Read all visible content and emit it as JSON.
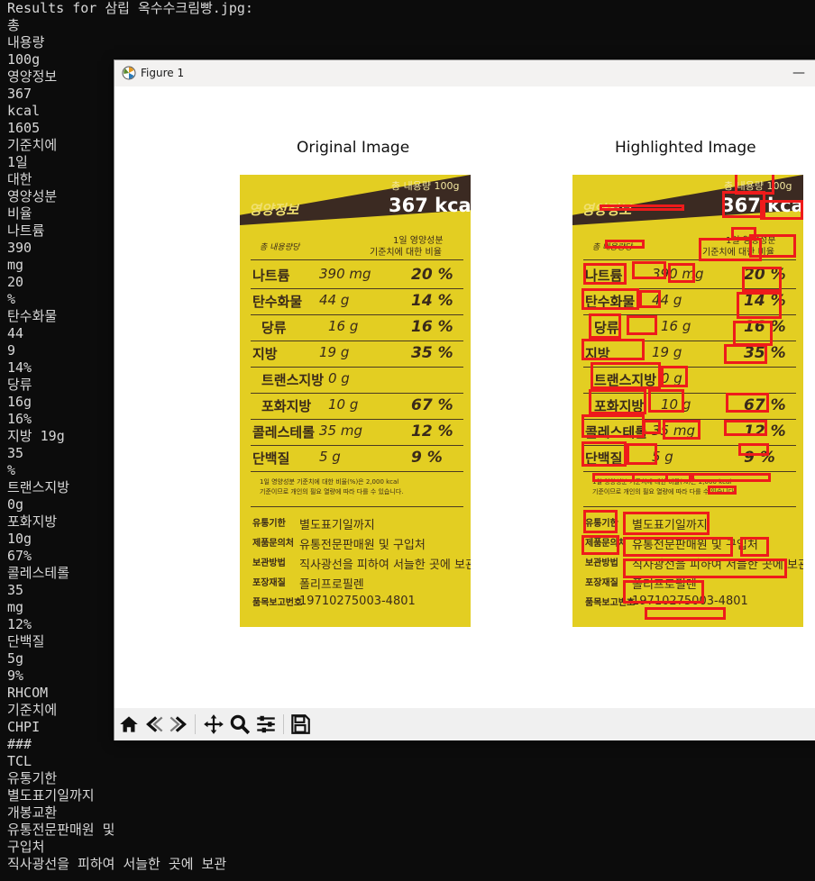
{
  "terminal": {
    "lines": [
      "Results for 삼립 옥수수크림빵.jpg:",
      "총",
      "내용량",
      "100g",
      "영양정보",
      "367",
      "kcal",
      "1605",
      "기준치에",
      "1일",
      "대한",
      "영양성분",
      "비율",
      "나트륨",
      "390",
      "mg",
      "20",
      "%",
      "탄수화물",
      "44",
      "9",
      "14%",
      "당류",
      "16g",
      "16%",
      "지방 19g",
      "35",
      "%",
      "트랜스지방",
      "0g",
      "포화지방",
      "10g",
      "67%",
      "콜레스테롤",
      "35",
      "mg",
      "12%",
      "단백질",
      "5g",
      "9%",
      "RHCOM",
      "기준치에",
      "CHPI",
      "###",
      "TCL",
      "유통기한",
      "별도표기일까지",
      "개봉교환",
      "유통전문판매원 및",
      "구입처",
      "직사광선을 피하여 서늘한 곳에 보관"
    ]
  },
  "window": {
    "title": "Figure 1",
    "min_glyph": "—"
  },
  "figure": {
    "left_title": "Original Image",
    "right_title": "Highlighted Image"
  },
  "label": {
    "top_line1": "총 내용량 100g",
    "top_line2": "367 kcal",
    "brand": "영양정보",
    "sub_left": "총 내용량당",
    "sub_right1": "1일 영양성분",
    "sub_right2": "기준치에 대한 비율",
    "rows": [
      {
        "name": "나트륨",
        "amount": "390 mg",
        "pct": "20 %"
      },
      {
        "name": "탄수화물",
        "amount": "44 g",
        "pct": "14 %"
      },
      {
        "name": "당류",
        "amount": "16 g",
        "pct": "16 %"
      },
      {
        "name": "지방",
        "amount": "19 g",
        "pct": "35 %"
      },
      {
        "name": "트랜스지방",
        "amount": "0 g",
        "pct": ""
      },
      {
        "name": "포화지방",
        "amount": "10 g",
        "pct": "67 %"
      },
      {
        "name": "콜레스테롤",
        "amount": "35 mg",
        "pct": "12 %"
      },
      {
        "name": "단백질",
        "amount": "5 g",
        "pct": "9 %"
      }
    ],
    "footnote1": "1일 영양성분 기준치에 대한 비율(%)은 2,000 kcal",
    "footnote2": "기준이므로 개인의 필요 열량에 따라 다를 수 있습니다.",
    "info": [
      {
        "k": "유통기한",
        "v": "별도표기일까지"
      },
      {
        "k": "제품문의처",
        "v": "유통전문판매원 및 구입처"
      },
      {
        "k": "보관방법",
        "v": "직사광선을 피하여 서늘한 곳에 보관"
      },
      {
        "k": "포장재질",
        "v": "폴리프로필렌"
      },
      {
        "k": "품목보고번호",
        "v": "19710275003-4801"
      }
    ]
  },
  "colors": {
    "highlight": "#ee1b1b",
    "label_yellow": "#e3ce22",
    "terminal_bg": "#0c0c0c"
  },
  "toolbar": {
    "icons": [
      "home-icon",
      "back-icon",
      "forward-icon",
      "pan-icon",
      "zoom-icon",
      "configure-icon",
      "save-icon"
    ]
  }
}
